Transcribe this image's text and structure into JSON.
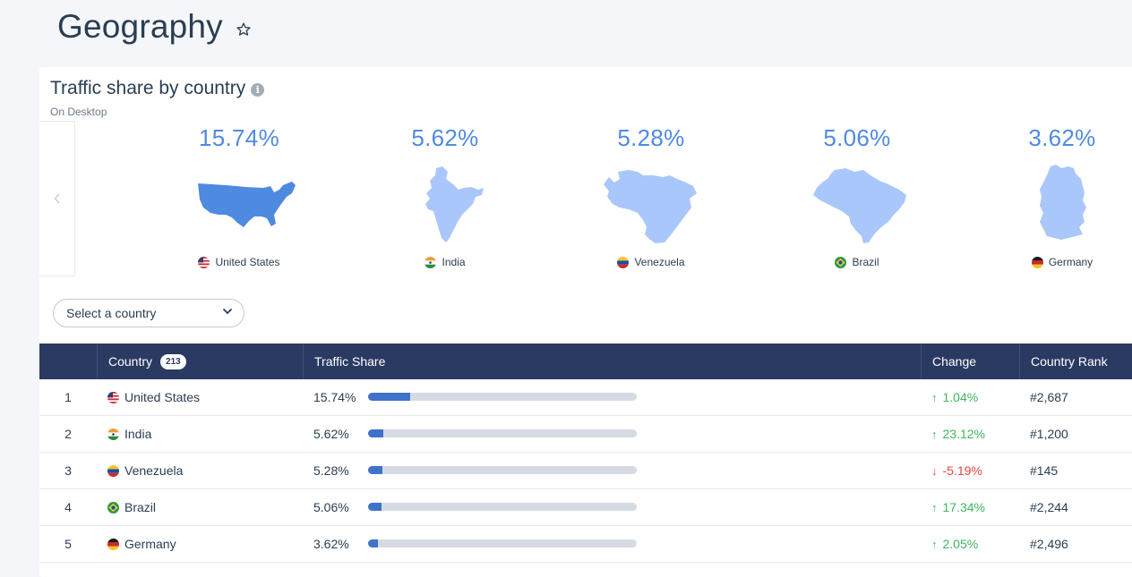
{
  "page": {
    "title": "Geography"
  },
  "card": {
    "title": "Traffic share by country",
    "subtitle": "On Desktop"
  },
  "maps": [
    {
      "pct": "15.74%",
      "country": "United States",
      "flag": "us",
      "active": true
    },
    {
      "pct": "5.62%",
      "country": "India",
      "flag": "in",
      "active": false
    },
    {
      "pct": "5.28%",
      "country": "Venezuela",
      "flag": "ve",
      "active": false
    },
    {
      "pct": "5.06%",
      "country": "Brazil",
      "flag": "br",
      "active": false
    },
    {
      "pct": "3.62%",
      "country": "Germany",
      "flag": "de",
      "active": false
    }
  ],
  "select": {
    "placeholder": "Select a country"
  },
  "table": {
    "headers": {
      "country": "Country",
      "country_count": "213",
      "traffic_share": "Traffic Share",
      "change": "Change",
      "rank": "Country Rank"
    },
    "rows": [
      {
        "num": "1",
        "country": "United States",
        "flag": "us",
        "share": "15.74%",
        "share_value": 15.74,
        "change": "1.04%",
        "direction": "up",
        "rank": "#2,687"
      },
      {
        "num": "2",
        "country": "India",
        "flag": "in",
        "share": "5.62%",
        "share_value": 5.62,
        "change": "23.12%",
        "direction": "up",
        "rank": "#1,200"
      },
      {
        "num": "3",
        "country": "Venezuela",
        "flag": "ve",
        "share": "5.28%",
        "share_value": 5.28,
        "change": "-5.19%",
        "direction": "down",
        "rank": "#145"
      },
      {
        "num": "4",
        "country": "Brazil",
        "flag": "br",
        "share": "5.06%",
        "share_value": 5.06,
        "change": "17.34%",
        "direction": "up",
        "rank": "#2,244"
      },
      {
        "num": "5",
        "country": "Germany",
        "flag": "de",
        "share": "3.62%",
        "share_value": 3.62,
        "change": "2.05%",
        "direction": "up",
        "rank": "#2,496"
      }
    ]
  },
  "colors": {
    "accent": "#4f8ae1",
    "map_active": "#4f8ae1",
    "map_inactive": "#a9c7fa",
    "header_bg": "#2b3a63",
    "bar_fill": "#3f72c9",
    "bar_track": "#d6dbe3",
    "positive": "#3eb55c",
    "negative": "#e5473a"
  }
}
